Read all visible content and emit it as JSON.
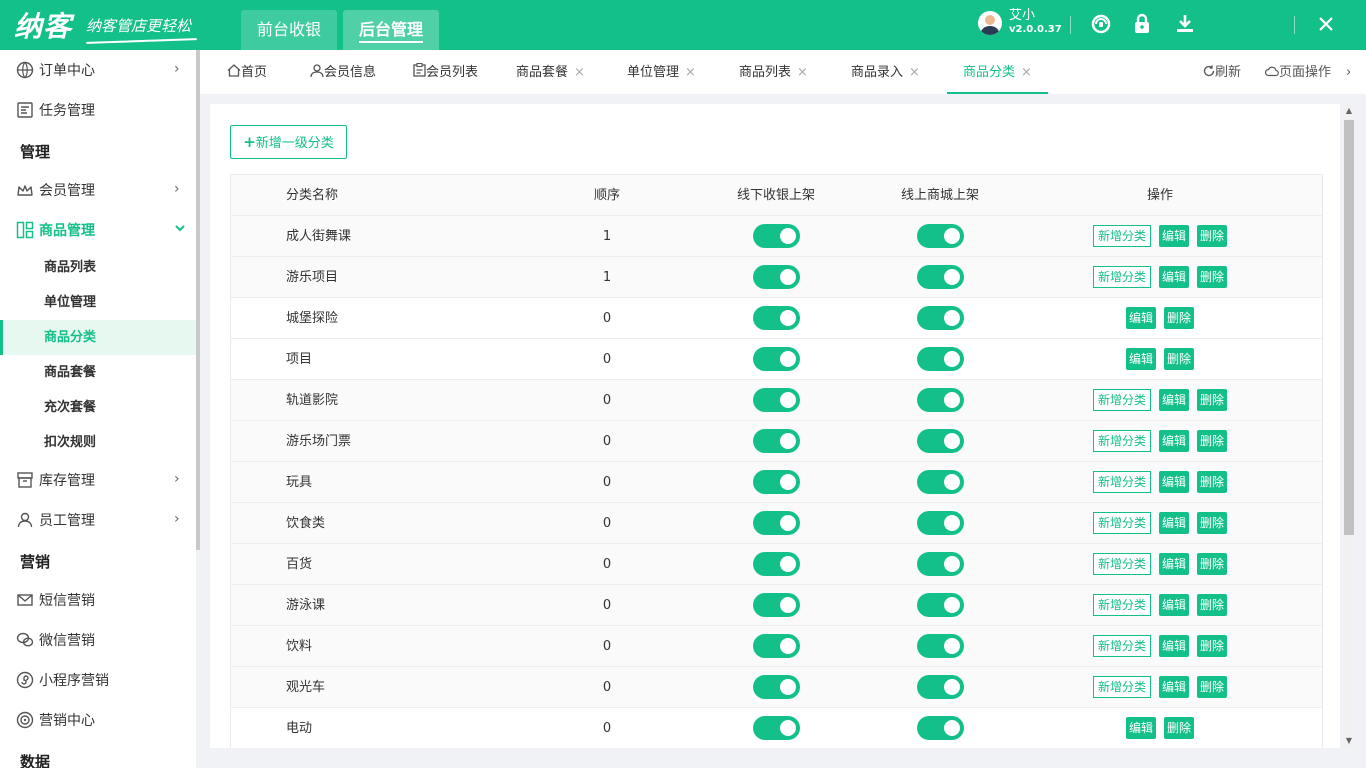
{
  "header": {
    "logo_main": "纳客",
    "logo_slogan": "纳客管店更轻松",
    "top_tabs": [
      "前台收银",
      "后台管理"
    ],
    "user_name": "艾小",
    "version": "v2.0.0.37"
  },
  "sidebar": {
    "order_center": "订单中心",
    "task_mgmt": "任务管理",
    "section_mgmt": "管理",
    "member_mgmt": "会员管理",
    "goods_mgmt": "商品管理",
    "sub_items": [
      "商品列表",
      "单位管理",
      "商品分类",
      "商品套餐",
      "充次套餐",
      "扣次规则"
    ],
    "stock_mgmt": "库存管理",
    "staff_mgmt": "员工管理",
    "section_marketing": "营销",
    "sms": "短信营销",
    "wechat": "微信营销",
    "miniapp": "小程序营销",
    "marketing_center": "营销中心",
    "section_data": "数据"
  },
  "tabs": {
    "home": "首页",
    "member_info": "会员信息",
    "member_list": "会员列表",
    "goods_combo": "商品套餐",
    "unit_mgmt": "单位管理",
    "goods_list": "商品列表",
    "goods_entry": "商品录入",
    "goods_category": "商品分类",
    "close": "×",
    "refresh": "刷新",
    "page_ops": "页面操作"
  },
  "content": {
    "add_button": "新增一级分类",
    "columns": {
      "name": "分类名称",
      "order": "顺序",
      "offline": "线下收银上架",
      "online": "线上商城上架",
      "ops": "操作"
    },
    "btn_add_sub": "新增分类",
    "btn_edit": "编辑",
    "btn_delete": "删除",
    "rows": [
      {
        "name": "成人街舞课",
        "order": "1"
      },
      {
        "name": "游乐项目",
        "order": "1"
      },
      {
        "name": "城堡探险",
        "order": "0"
      },
      {
        "name": "项目",
        "order": "0"
      },
      {
        "name": "轨道影院",
        "order": "0"
      },
      {
        "name": "游乐场门票",
        "order": "0"
      },
      {
        "name": "玩具",
        "order": "0"
      },
      {
        "name": "饮食类",
        "order": "0"
      },
      {
        "name": "百货",
        "order": "0"
      },
      {
        "name": "游泳课",
        "order": "0"
      },
      {
        "name": "饮料",
        "order": "0"
      },
      {
        "name": "观光车",
        "order": "0"
      },
      {
        "name": "电动",
        "order": "0"
      }
    ]
  },
  "colors": {
    "accent": "#14c08a"
  }
}
